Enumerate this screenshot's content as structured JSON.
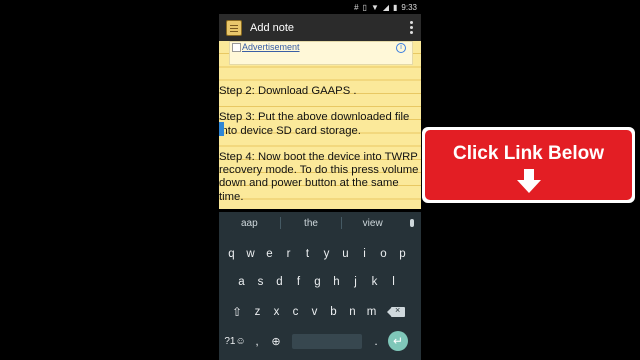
{
  "status_bar": {
    "icons": [
      "hash-icon",
      "vibrate-icon",
      "wifi-icon",
      "signal-icon",
      "battery-icon"
    ],
    "time": "9:33"
  },
  "action_bar": {
    "title": "Add note",
    "icon": "notepad-icon",
    "overflow_icon": "more-vert-icon"
  },
  "ad": {
    "label": "Advertisement",
    "info_icon": "i"
  },
  "note": {
    "text": "Step 2: Download GAAPS .\n\nStep 3: Put the above downloaded file into device SD card storage.\n\nStep 4: Now boot the device into TWRP recovery mode. To do this press volume down and power button at the same time."
  },
  "suggestions": [
    "aap",
    "the",
    "view"
  ],
  "keyboard": {
    "row1": [
      "q",
      "w",
      "e",
      "r",
      "t",
      "y",
      "u",
      "i",
      "o",
      "p"
    ],
    "row2": [
      "a",
      "s",
      "d",
      "f",
      "g",
      "h",
      "j",
      "k",
      "l"
    ],
    "row3": [
      "z",
      "x",
      "c",
      "v",
      "b",
      "n",
      "m"
    ],
    "symbols_key": "?1☺",
    "comma_key": ",",
    "dot_key": ".",
    "enter_key": "↵"
  },
  "overlay": {
    "cta_text": "Click Link Below",
    "colors": {
      "cta_bg": "#e31e24",
      "note_bg": "#fbe99a",
      "keyboard_bg": "#263238"
    }
  }
}
